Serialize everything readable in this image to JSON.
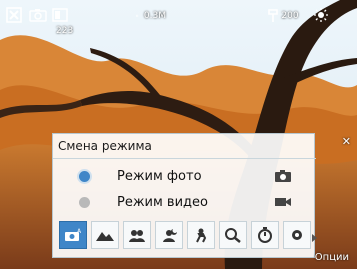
{
  "status": {
    "count": "223",
    "resolution": "0.3M",
    "iso": "200"
  },
  "panel": {
    "title": "Смена режима",
    "options": [
      {
        "label": "Режим фото",
        "icon": "camera-icon",
        "selected": true,
        "dot_color": "#3f86c8"
      },
      {
        "label": "Режим видео",
        "icon": "video-camera-icon",
        "selected": false,
        "dot_color": "#b9b9b9"
      }
    ],
    "scenes": [
      {
        "icon": "auto-scene-icon",
        "active": true
      },
      {
        "icon": "landscape-icon",
        "active": false
      },
      {
        "icon": "portrait-icon",
        "active": false
      },
      {
        "icon": "night-icon",
        "active": false
      },
      {
        "icon": "sports-icon",
        "active": false
      },
      {
        "icon": "close-up-icon",
        "active": false
      },
      {
        "icon": "timer-icon",
        "active": false
      }
    ]
  },
  "footer": {
    "menu_label": "Опции"
  },
  "colors": {
    "accent": "#3f86c8",
    "sky": "#e9f2f8",
    "foliage": "#d47a2a",
    "panel": "#ffffff"
  }
}
